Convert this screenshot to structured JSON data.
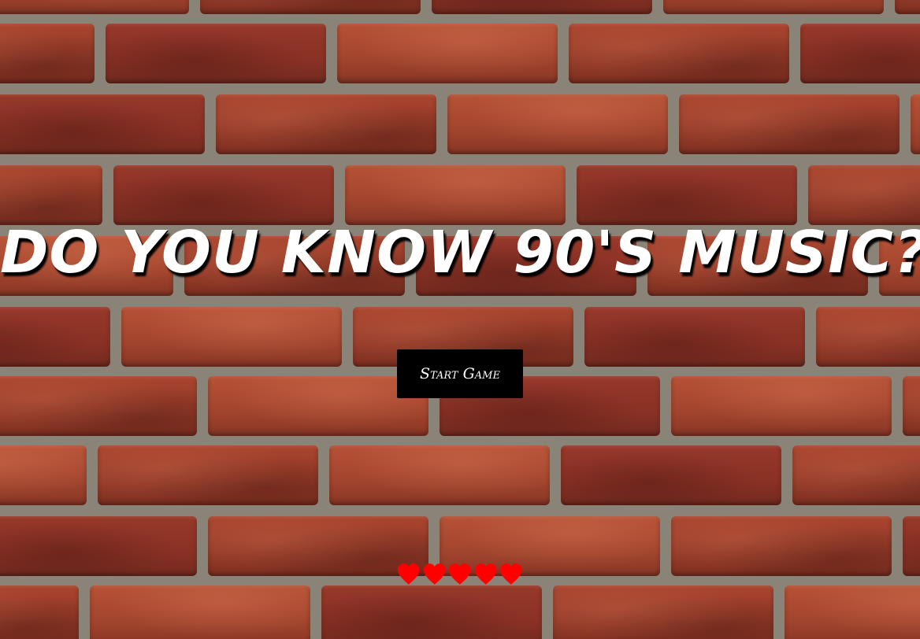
{
  "game": {
    "title": "DO YOU KNOW 90'S MUSIC?",
    "start_button_label": "Start Game"
  },
  "lives": {
    "remaining": 5,
    "max": 5,
    "icon": "heart-icon",
    "color": "#ff0000"
  },
  "theme": {
    "background": "brick-wall",
    "title_color": "#ffffff",
    "button_background": "#000000",
    "button_text_color": "#ffffff"
  }
}
